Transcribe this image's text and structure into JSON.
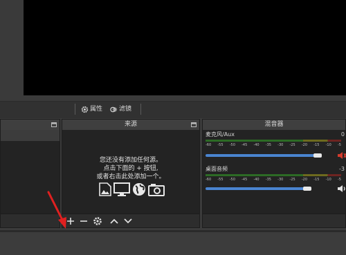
{
  "toolbar": {
    "properties_label": "属性",
    "filters_label": "滤镜"
  },
  "docks": {
    "scenes": {
      "title": ""
    },
    "sources": {
      "title": "来源",
      "empty_hint": [
        "您还没有添加任何源。",
        "点击下面的 + 按钮,",
        "或者右击此处添加一个。"
      ]
    },
    "mixer": {
      "title": "混音器",
      "channels": [
        {
          "name": "麦克风/Aux",
          "db": "0",
          "meter_level": 0.0,
          "volume": 0.88,
          "muted": true,
          "mute_color": "#d43b2d"
        },
        {
          "name": "桌面音频",
          "db": "-3",
          "meter_level": 0.0,
          "volume": 0.8,
          "muted": false,
          "mute_color": "#e2e2e2"
        }
      ],
      "scale_ticks": [
        "-60",
        "-55",
        "-50",
        "-45",
        "-40",
        "-35",
        "-30",
        "-25",
        "-20",
        "-15",
        "-10",
        "-5"
      ]
    }
  },
  "icons": {
    "properties": "gear-icon",
    "filters": "filter-icon",
    "add": "plus-icon",
    "remove": "minus-icon",
    "settings": "gear-icon",
    "move_up": "chevron-up-icon",
    "move_down": "chevron-down-icon",
    "float": "float-window-icon",
    "hint_icons": [
      "image-icon",
      "monitor-icon",
      "globe-icon",
      "camera-icon"
    ]
  },
  "colors": {
    "background": "#3b3b3b",
    "preview": "#000000",
    "accent_slider": "#4a84d0",
    "annotation_arrow": "#e02020"
  }
}
